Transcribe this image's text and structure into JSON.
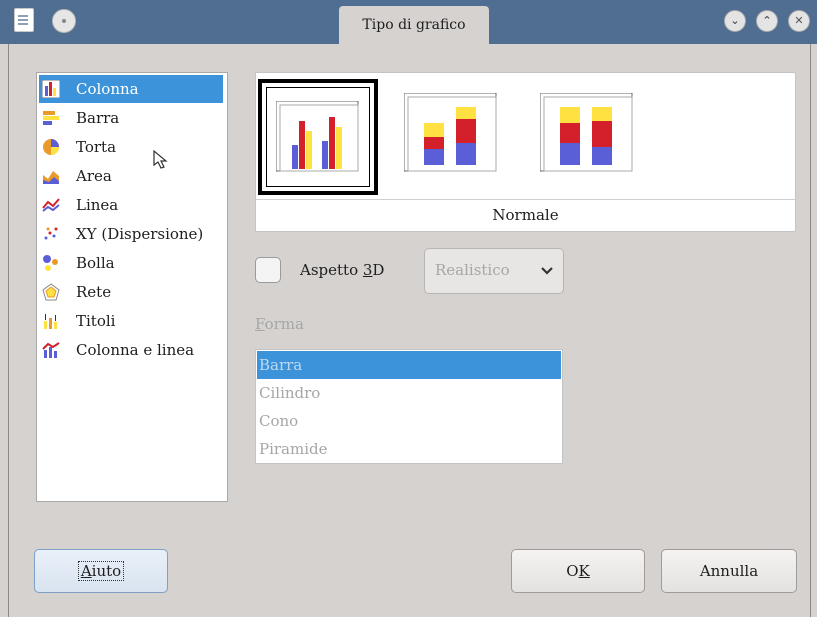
{
  "window": {
    "title": "Tipo di grafico"
  },
  "chart_types": [
    {
      "label": "Colonna",
      "icon": "column-chart-icon",
      "selected": true
    },
    {
      "label": "Barra",
      "icon": "bar-chart-icon",
      "selected": false
    },
    {
      "label": "Torta",
      "icon": "pie-chart-icon",
      "selected": false
    },
    {
      "label": "Area",
      "icon": "area-chart-icon",
      "selected": false
    },
    {
      "label": "Linea",
      "icon": "line-chart-icon",
      "selected": false
    },
    {
      "label": "XY (Dispersione)",
      "icon": "scatter-chart-icon",
      "selected": false
    },
    {
      "label": "Bolla",
      "icon": "bubble-chart-icon",
      "selected": false
    },
    {
      "label": "Rete",
      "icon": "net-chart-icon",
      "selected": false
    },
    {
      "label": "Titoli",
      "icon": "stock-chart-icon",
      "selected": false
    },
    {
      "label": "Colonna e linea",
      "icon": "column-line-chart-icon",
      "selected": false
    }
  ],
  "variants": {
    "selected_caption": "Normale",
    "items": [
      {
        "icon": "column-normal-icon",
        "selected": true
      },
      {
        "icon": "column-stacked-icon",
        "selected": false
      },
      {
        "icon": "column-percent-stacked-icon",
        "selected": false
      }
    ]
  },
  "aspect3d": {
    "label_pre": "Aspetto ",
    "label_accel": "3",
    "label_post": "D",
    "checked": false
  },
  "scheme": {
    "value": "Realistico",
    "enabled": false
  },
  "shape": {
    "label_accel": "F",
    "label_rest": "orma",
    "options": [
      "Barra",
      "Cilindro",
      "Cono",
      "Piramide"
    ],
    "selected": "Barra"
  },
  "buttons": {
    "help_accel": "A",
    "help_rest": "iuto",
    "ok_pre": "O",
    "ok_accel": "K",
    "cancel": "Annulla"
  },
  "colors": {
    "selection": "#3d93d9",
    "titlebar": "#4f6e92",
    "bar_blue": "#5a5fd8",
    "bar_red": "#d4202a",
    "bar_yellow": "#ffe142"
  }
}
